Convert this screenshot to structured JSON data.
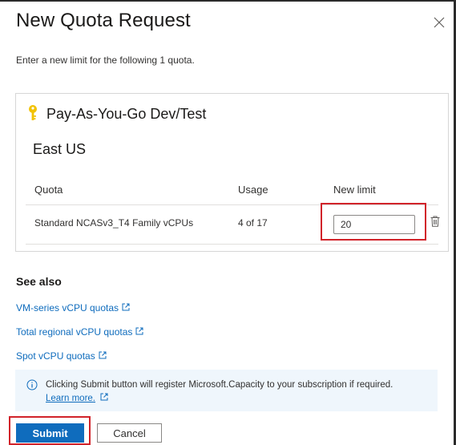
{
  "dialog": {
    "title": "New Quota Request",
    "close_icon": "close-icon"
  },
  "intro_text": "Enter a new limit for the following 1 quota.",
  "subscription": {
    "icon": "key-icon",
    "name": "Pay-As-You-Go Dev/Test",
    "region": "East US",
    "table": {
      "headers": [
        "Quota",
        "Usage",
        "New limit"
      ],
      "rows": [
        {
          "quota": "Standard NCASv3_T4 Family vCPUs",
          "usage": "4 of 17",
          "new_limit": "20"
        }
      ]
    },
    "delete_icon": "trash-icon"
  },
  "see_also": {
    "heading": "See also",
    "links": [
      "VM-series vCPU quotas",
      "Total regional vCPU quotas",
      "Spot vCPU quotas"
    ],
    "link_icon": "external-link-icon"
  },
  "info": {
    "icon": "info-icon",
    "text": "Clicking Submit button will register Microsoft.Capacity to your subscription if required.",
    "learn_more": "Learn more."
  },
  "buttons": {
    "submit": "Submit",
    "cancel": "Cancel"
  },
  "colors": {
    "accent": "#0f6cbd",
    "highlight": "#d1232a",
    "info_background": "#eff6fc",
    "key": "#f2c200"
  }
}
